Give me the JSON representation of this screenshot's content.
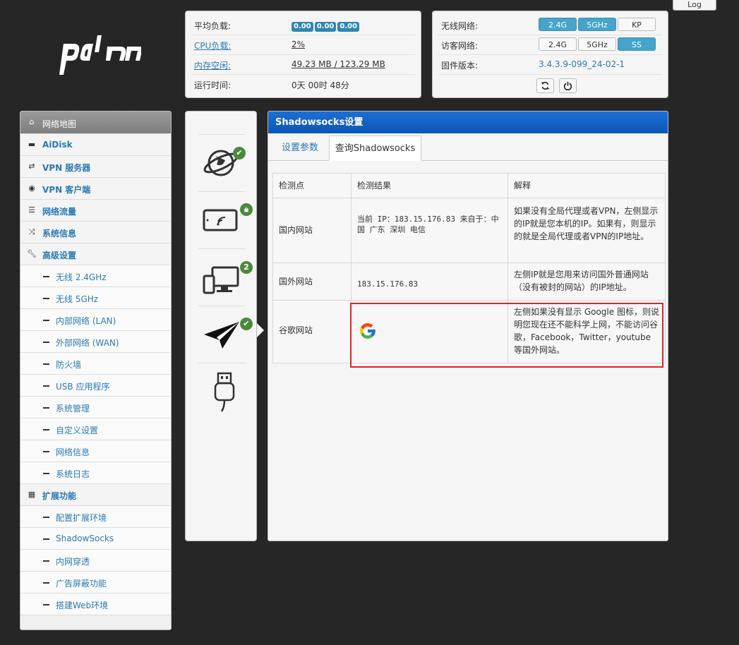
{
  "log_label": "Log",
  "status": {
    "load_label": "平均负载:",
    "load_values": [
      "0.00",
      "0.00",
      "0.00"
    ],
    "cpu_label": "CPU负载:",
    "cpu_value": "2%",
    "mem_label": "内存空闲:",
    "mem_value": "49.23 MB / 123.29 MB",
    "uptime_label": "运行时间:",
    "uptime_value": "0天 00时 48分"
  },
  "network": {
    "wifi_label": "无线网络:",
    "wifi_buttons": [
      "2.4G",
      "5GHz",
      "KP"
    ],
    "guest_label": "访客网络:",
    "guest_buttons": [
      "2.4G",
      "5GHz",
      "SS"
    ],
    "fw_label": "固件版本:",
    "fw_value": "3.4.3.9-099_24-02-1"
  },
  "sidebar": {
    "items": [
      {
        "label": "网络地图",
        "icon": "home-icon"
      },
      {
        "label": "AiDisk",
        "icon": "disk-icon"
      },
      {
        "label": "VPN 服务器",
        "icon": "vpn-server-icon"
      },
      {
        "label": "VPN 客户端",
        "icon": "globe-icon"
      },
      {
        "label": "网络流量",
        "icon": "traffic-icon"
      },
      {
        "label": "系统信息",
        "icon": "shuffle-icon"
      },
      {
        "label": "高级设置",
        "icon": "wrench-icon"
      },
      {
        "label": "无线 2.4GHz"
      },
      {
        "label": "无线 5GHz"
      },
      {
        "label": "内部网络 (LAN)"
      },
      {
        "label": "外部网络 (WAN)"
      },
      {
        "label": "防火墙"
      },
      {
        "label": "USB 应用程序"
      },
      {
        "label": "系统管理"
      },
      {
        "label": "自定义设置"
      },
      {
        "label": "网络信息"
      },
      {
        "label": "系统日志"
      },
      {
        "label": "扩展功能",
        "icon": "grid-icon"
      },
      {
        "label": "配置扩展环境"
      },
      {
        "label": "ShadowSocks"
      },
      {
        "label": "内网穿透"
      },
      {
        "label": "广告屏蔽功能"
      },
      {
        "label": "搭建Web环境"
      }
    ]
  },
  "icon_status": {
    "devices_count": "2"
  },
  "main": {
    "title": "Shadowsocks设置",
    "tabs": [
      "设置参数",
      "查询Shadowsocks"
    ],
    "table": {
      "headers": [
        "检测点",
        "检测结果",
        "解释"
      ],
      "rows": [
        {
          "point": "国内网站",
          "result": "当前 IP：183.15.176.83  来自于：中国 广东 深圳  电信",
          "note": "如果没有全局代理或者VPN，左侧显示的IP就是您本机的IP。如果有，则显示的就是全局代理或者VPN的IP地址。"
        },
        {
          "point": "国外网站",
          "result": "183.15.176.83",
          "note": "左侧IP就是您用来访问国外普通网站（没有被封的网站）的IP地址。"
        },
        {
          "point": "谷歌网站",
          "result": "",
          "note": "左侧如果没有显示 Google 图标，则说明您现在还不能科学上网，不能访问谷歌，Facebook，Twitter，youtube 等国外网站。"
        }
      ]
    }
  }
}
